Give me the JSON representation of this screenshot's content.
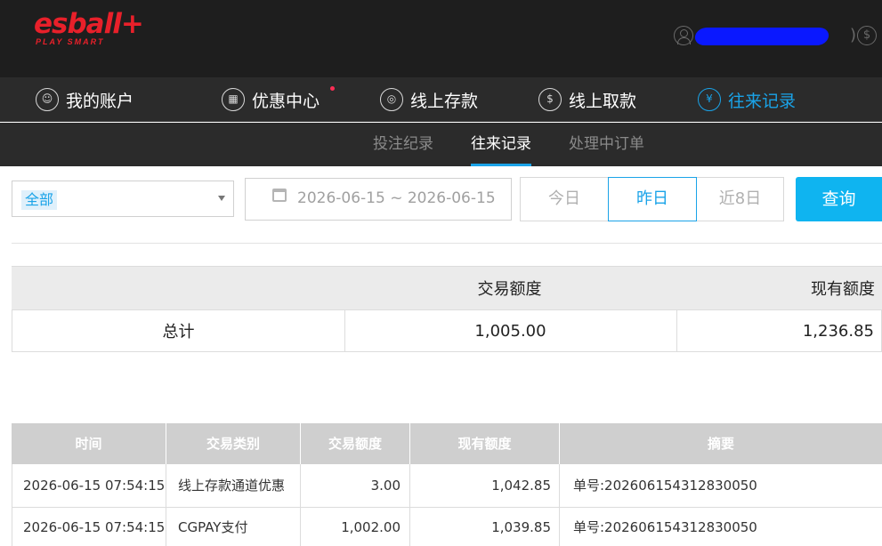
{
  "header": {
    "logo_main": "esball+",
    "logo_sub": "PLAY SMART",
    "user_paren": ")"
  },
  "main_nav": [
    {
      "label": "我的账户",
      "icon": "user-icon",
      "active": false
    },
    {
      "label": "优惠中心",
      "icon": "gift-icon",
      "active": false,
      "badge": true
    },
    {
      "label": "线上存款",
      "icon": "deposit-icon",
      "active": false
    },
    {
      "label": "线上取款",
      "icon": "withdraw-icon",
      "active": false
    },
    {
      "label": "往来记录",
      "icon": "records-icon",
      "active": true
    }
  ],
  "sub_nav": [
    {
      "label": "投注纪录",
      "active": false
    },
    {
      "label": "往来记录",
      "active": true
    },
    {
      "label": "处理中订单",
      "active": false
    }
  ],
  "filter": {
    "type_selected": "全部",
    "date_range": "2026-06-15 ~ 2026-06-15",
    "quick_buttons": [
      "今日",
      "昨日",
      "近8日"
    ],
    "quick_active": "昨日",
    "query_label": "查询"
  },
  "summary": {
    "headers": [
      "",
      "交易额度",
      "现有额度"
    ],
    "row": {
      "label": "总计",
      "amount": "1,005.00",
      "balance": "1,236.85"
    }
  },
  "detail": {
    "headers": [
      "时间",
      "交易类别",
      "交易额度",
      "现有额度",
      "摘要"
    ],
    "rows": [
      {
        "time": "2026-06-15 07:54:15",
        "type": "线上存款通道优惠",
        "amount": "3.00",
        "balance": "1,042.85",
        "memo": "单号:202606154312830050"
      },
      {
        "time": "2026-06-15 07:54:15",
        "type": "CGPAY支付",
        "amount": "1,002.00",
        "balance": "1,039.85",
        "memo": "单号:202606154312830050"
      }
    ]
  },
  "colors": {
    "accent": "#1aa3e8",
    "query_button": "#0fb4f0",
    "logo": "#e8202a",
    "header_bg": "#1e1e1e",
    "nav_bg": "#2b2b2b"
  }
}
